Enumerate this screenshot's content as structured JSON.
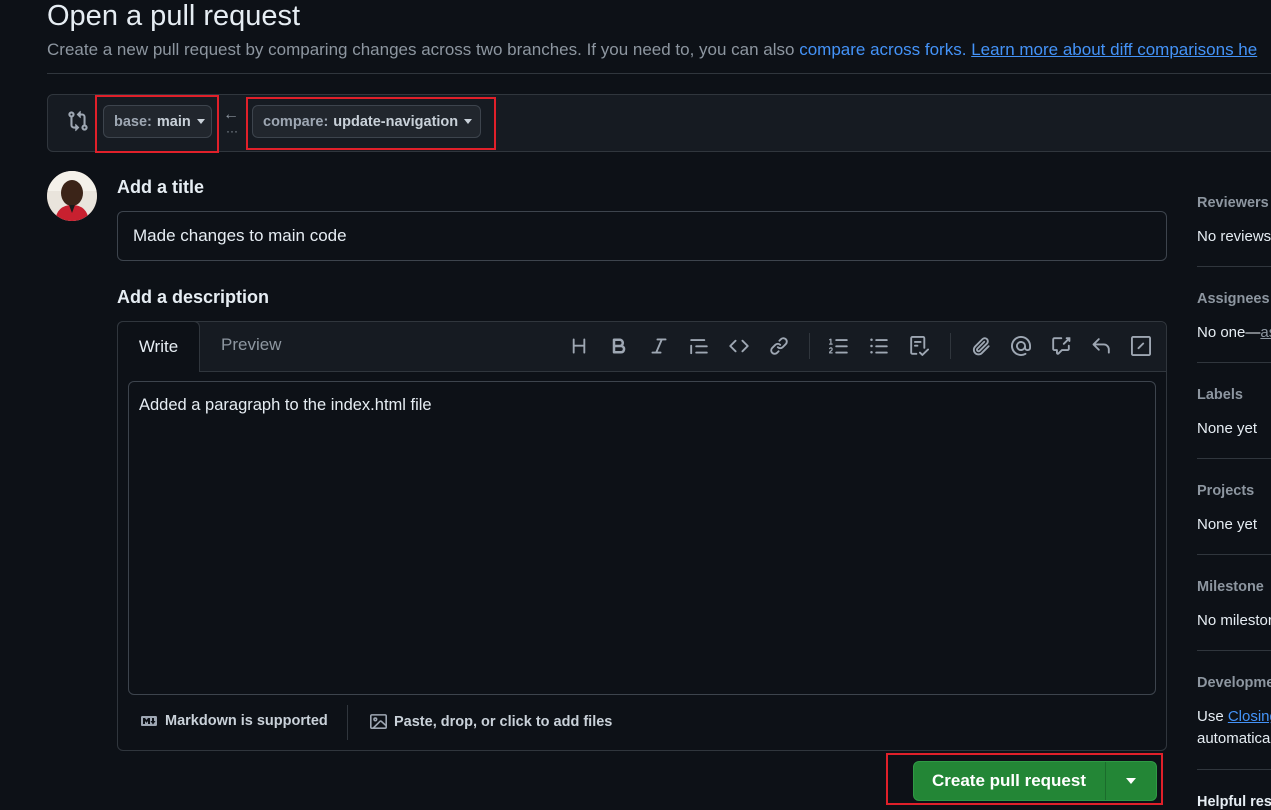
{
  "header": {
    "title": "Open a pull request",
    "subtitle_text": "Create a new pull request by comparing changes across two branches. If you need to, you can also ",
    "forks_link": "compare across forks.",
    "learn_link": "Learn more about diff comparisons he"
  },
  "range": {
    "base_label": "base:",
    "base_value": "main",
    "compare_label": "compare:",
    "compare_value": "update-navigation",
    "arrow": "←",
    "dots": "···"
  },
  "form": {
    "title_heading": "Add a title",
    "title_value": "Made changes to main code",
    "desc_heading": "Add a description",
    "tab_write": "Write",
    "tab_preview": "Preview",
    "desc_value": "Added a paragraph to the index.html file",
    "markdown_note": "Markdown is supported",
    "attach_note": "Paste, drop, or click to add files",
    "create_button": "Create pull request"
  },
  "sidebar": {
    "reviewers_title": "Reviewers",
    "reviewers_value": "No reviews",
    "assignees_title": "Assignees",
    "assignees_value": "No one—",
    "assignees_link": "as",
    "labels_title": "Labels",
    "labels_value": "None yet",
    "projects_title": "Projects",
    "projects_value": "None yet",
    "milestone_title": "Milestone",
    "milestone_value": "No milestor",
    "development_title": "Developme",
    "development_use": "Use ",
    "development_link": "Closing",
    "development_line2": "automatica",
    "helpful_title": "Helpful res"
  },
  "colors": {
    "background": "#0d1117",
    "accent_link": "#4493f8",
    "primary_button": "#238636",
    "highlight_box": "#e0202a"
  },
  "icons": [
    "git-compare-icon",
    "arrow-left-icon",
    "heading-icon",
    "bold-icon",
    "italic-icon",
    "quote-icon",
    "code-icon",
    "link-icon",
    "ordered-list-icon",
    "unordered-list-icon",
    "task-list-icon",
    "paperclip-icon",
    "mention-icon",
    "cross-reference-icon",
    "reply-icon",
    "slash-command-icon",
    "markdown-icon",
    "image-icon",
    "triangle-down-icon"
  ]
}
